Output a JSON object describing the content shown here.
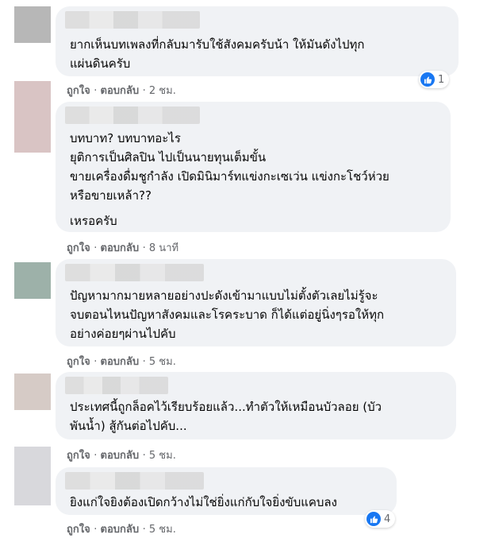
{
  "comments": [
    {
      "lines": [
        "ยากเห็นบทเพลงที่กลับมารับใช้สังคมครับน้า ให้มันดังไปทุก",
        "แผ่นดินครับ"
      ],
      "like_label": "ถูกใจ",
      "reply_label": "ตอบกลับ",
      "time": "2 ชม.",
      "reaction_count": "1",
      "avatar_color": "#b7b7b7"
    },
    {
      "lines": [
        "บทบาท? บทบาทอะไร",
        "ยุติการเป็นศิลปิน ไปเป็นนายทุนเต็มขั้น",
        "ขายเครื่องดื่มชูกำลัง เปิดมินิมาร์ทแข่งกะเซเว่น แข่งกะโชว์ห่วย",
        "หรือขายเหล้า??",
        "",
        "เหรอครับ"
      ],
      "like_label": "ถูกใจ",
      "reply_label": "ตอบกลับ",
      "time": "8 นาที",
      "avatar_color": "#d9c4c4"
    },
    {
      "lines": [
        "ปัญหามากมายหลายอย่างปะดังเข้ามาแบบไม่ตั้งตัวเลยไม่รู้จะ",
        "จบตอนไหนปัญหาสังคมและโรคระบาด ก็ได้แต่อยู่นิ่งๆรอให้ทุก",
        "อย่างค่อยๆผ่านไปคับ"
      ],
      "like_label": "ถูกใจ",
      "reply_label": "ตอบกลับ",
      "time": "5 ชม.",
      "avatar_color": "#9db1a9"
    },
    {
      "lines": [
        "ประเทศนี้ถูกล็อคไว้เรียบร้อยแล้ว...ทำตัวให้เหมือนบัวลอย (บัว",
        "พันน้ำ) สู้กันต่อไปคับ..."
      ],
      "like_label": "ถูกใจ",
      "reply_label": "ตอบกลับ",
      "time": "5 ชม.",
      "avatar_color": "#d6cbc6"
    },
    {
      "lines": [
        "ยิงแก่ใจยิงต้องเปิดกว้างไม่ใช่ยิ่งแก่กับใจยิ่งขับแคบลง"
      ],
      "like_label": "ถูกใจ",
      "reply_label": "ตอบกลับ",
      "time": "5 ชม.",
      "reaction_count": "4",
      "avatar_color": "#d8d8dc"
    }
  ]
}
